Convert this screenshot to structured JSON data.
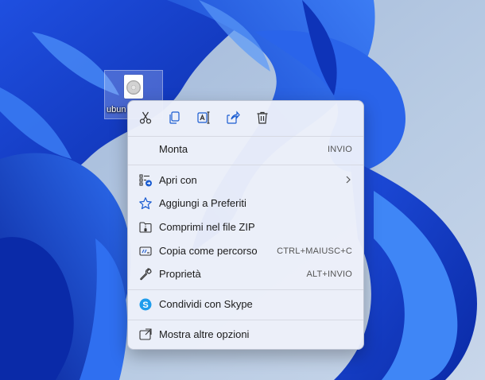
{
  "desktop": {
    "file_icon": {
      "name": "ubun",
      "icon": "disc-image-file-icon"
    }
  },
  "context_menu": {
    "quick_actions": [
      {
        "name": "cut-icon"
      },
      {
        "name": "copy-icon"
      },
      {
        "name": "rename-icon"
      },
      {
        "name": "share-icon"
      },
      {
        "name": "delete-icon"
      }
    ],
    "items": [
      {
        "label": "Monta",
        "shortcut": "INVIO"
      },
      {
        "label": "Apri con",
        "submenu": true,
        "icon": "open-with-icon"
      },
      {
        "label": "Aggiungi a Preferiti",
        "icon": "star-icon"
      },
      {
        "label": "Comprimi nel file ZIP",
        "icon": "zip-folder-icon"
      },
      {
        "label": "Copia come percorso",
        "shortcut": "CTRL+MAIUSC+C",
        "icon": "copy-path-icon"
      },
      {
        "label": "Proprietà",
        "shortcut": "ALT+INVIO",
        "icon": "wrench-icon"
      },
      {
        "label": "Condividi con Skype",
        "icon": "skype-icon"
      },
      {
        "label": "Mostra altre opzioni",
        "icon": "more-options-icon"
      }
    ]
  },
  "colors": {
    "accent": "#1a5cd1",
    "wallpaper_dark": "#0b2fb0",
    "wallpaper_light": "#bcd0e6"
  }
}
